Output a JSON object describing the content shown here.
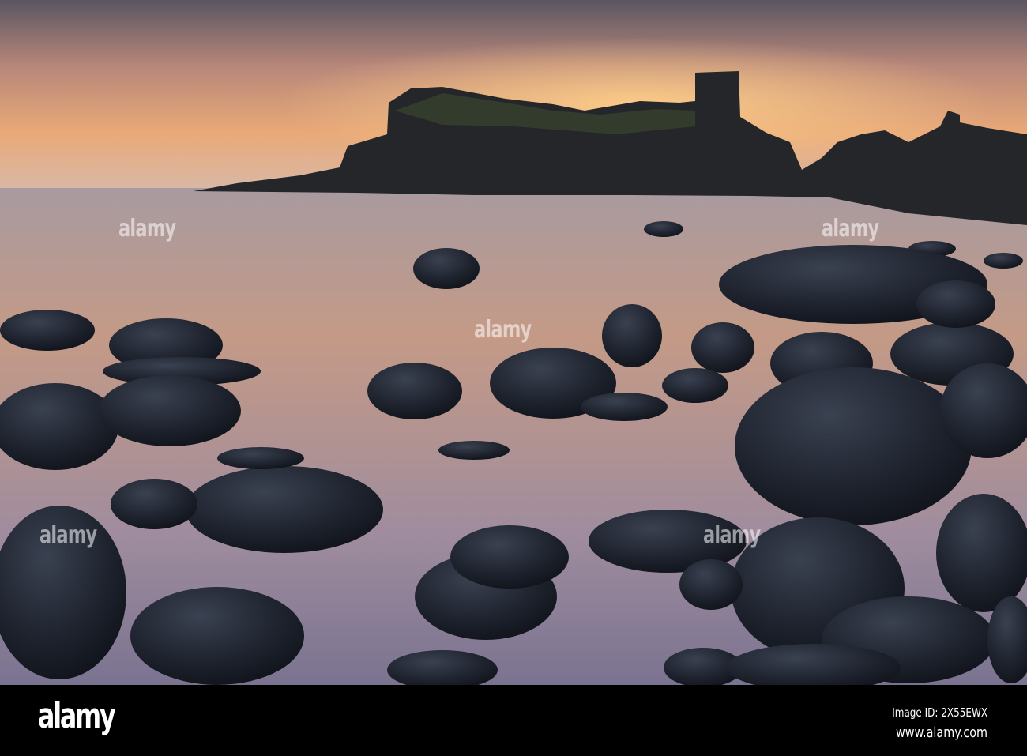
{
  "watermark": {
    "text": "alamy"
  },
  "footer": {
    "logo": "alamy",
    "image_id": "Image ID: 2X55EWX",
    "url": "www.alamy.com"
  },
  "colors": {
    "sky_top": "#5e5a66",
    "sky_glow": "#f2b07a",
    "water": "#b89a94",
    "rock": "#1c2230",
    "footer": "#000000"
  }
}
